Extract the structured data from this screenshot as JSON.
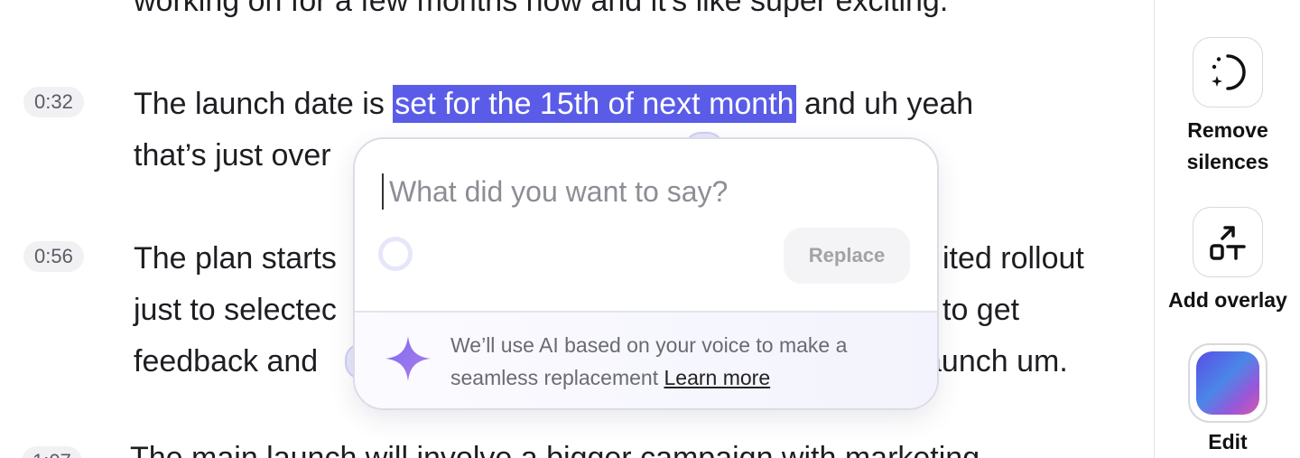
{
  "transcript": {
    "top_partial": "working on for a few months now and it's like super exciting.",
    "blocks": [
      {
        "timestamp": "0:32",
        "line1_before": "The launch date is ",
        "line1_highlight": "set for the 15th of next month",
        "line1_after": " and uh yeah",
        "line2_visible": "that’s just over"
      },
      {
        "timestamp": "0:56",
        "line1_left": "The plan starts",
        "line1_right": "ited rollout",
        "line2_left": "just to selectec",
        "line2_right": "to get",
        "line3_left": "feedback and",
        "line3_right": "aunch um."
      }
    ],
    "bottom_partial_timestamp": "1:07",
    "bottom_partial": "The main launch will involve a bigger campaign with marketing"
  },
  "popover": {
    "input_placeholder": "What did you want to say?",
    "input_value": "",
    "replace_label": "Replace",
    "note_text": "We’ll use AI based on your voice to make a seamless replacement",
    "learn_more": "Learn more"
  },
  "sidebar": {
    "tools": [
      {
        "label": "Remove silences",
        "icon": "remove-silences-icon"
      },
      {
        "label": "Add overlay",
        "icon": "add-overlay-icon"
      },
      {
        "label": "Edit",
        "icon": "edit-gradient-icon"
      }
    ]
  },
  "colors": {
    "highlight": "#5a5ce8",
    "sparkle": "#6b6ef0"
  }
}
